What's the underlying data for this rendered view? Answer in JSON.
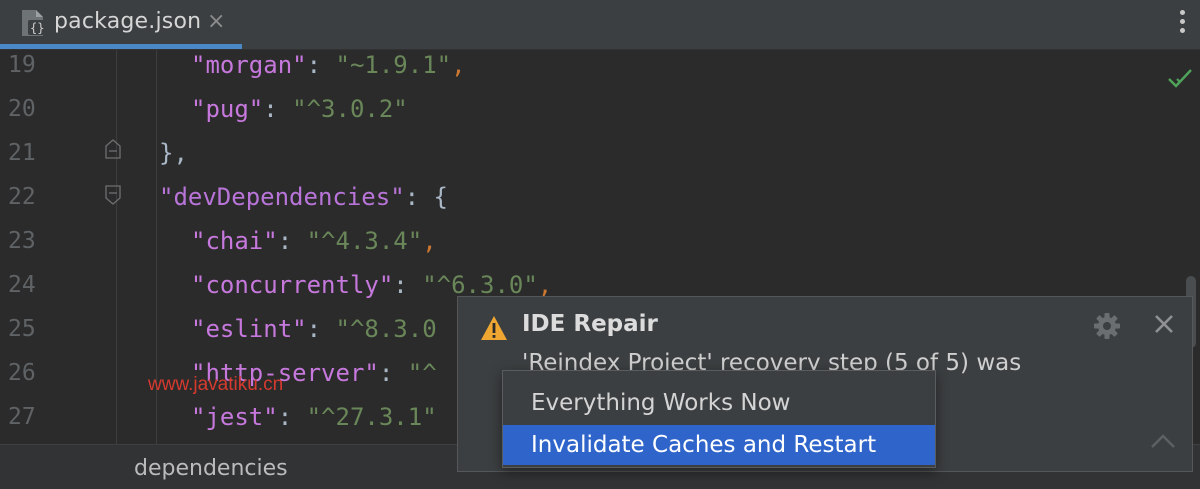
{
  "tab": {
    "title": "package.json",
    "close": "×"
  },
  "editor": {
    "lines": [
      {
        "num": "19",
        "key": "\"morgan\"",
        "value": "\"~1.9.1\"",
        "trail": ","
      },
      {
        "num": "20",
        "key": "\"pug\"",
        "value": "\"^3.0.2\"",
        "trail": ""
      },
      {
        "num": "21",
        "text": "},"
      },
      {
        "num": "22",
        "key": "\"devDependencies\"",
        "value": "{",
        "trail": ""
      },
      {
        "num": "23",
        "key": "\"chai\"",
        "value": "\"^4.3.4\"",
        "trail": ","
      },
      {
        "num": "24",
        "key": "\"concurrently\"",
        "value": "\"^6.3.0\"",
        "trail": ","
      },
      {
        "num": "25",
        "key": "\"eslint\"",
        "value": "\"^8.3.0",
        "trail": ""
      },
      {
        "num": "26",
        "key": "\"http-server\"",
        "value": "\"^",
        "trail": ""
      },
      {
        "num": "27",
        "key": "\"jest\"",
        "value": "\"^27.3.1\"",
        "trail": ""
      }
    ]
  },
  "breadcrumb": {
    "path": "dependencies"
  },
  "notification": {
    "title": "IDE Repair",
    "body": "'Reindex Project' recovery step (5 of 5) was"
  },
  "menu": {
    "items": [
      {
        "label": "Everything Works Now",
        "selected": false
      },
      {
        "label": "Invalidate Caches and Restart",
        "selected": true
      }
    ]
  },
  "watermark": "www.javatiku.cn",
  "colors": {
    "accent": "#4a88c7",
    "selection": "#2f65ca",
    "warning": "#f0a732",
    "success": "#4fa35a"
  }
}
